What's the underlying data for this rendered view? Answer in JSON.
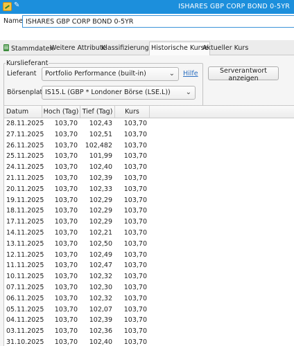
{
  "window": {
    "title": "ISHARES GBP CORP BOND 0-5YR"
  },
  "name_row": {
    "label": "Name",
    "value": "ISHARES GBP CORP BOND 0-5YR"
  },
  "tabs": [
    {
      "label": "Stammdaten",
      "active": false
    },
    {
      "label": "Weitere Attribute",
      "active": false
    },
    {
      "label": "Klassifizierungen",
      "active": false
    },
    {
      "label": "Historische Kurse",
      "active": true
    },
    {
      "label": "Aktueller Kurs",
      "active": false
    }
  ],
  "kurslieferant": {
    "legend": "Kurslieferant",
    "lieferant_label": "Lieferant",
    "lieferant_value": "Portfolio Performance (built-in)",
    "help_link": "Hilfe",
    "server_button": "Serverantwort anzeigen",
    "boersenplatz_label": "Börsenplatz",
    "boersenplatz_value": "IS15.L (GBP * Londoner Börse (LSE.L))"
  },
  "table": {
    "headers": [
      "Datum",
      "Hoch (Tag)",
      "Tief (Tag)",
      "Kurs"
    ],
    "rows": [
      [
        "28.11.2025",
        "103,70",
        "102,43",
        "103,70"
      ],
      [
        "27.11.2025",
        "103,70",
        "102,51",
        "103,70"
      ],
      [
        "26.11.2025",
        "103,70",
        "102,482",
        "103,70"
      ],
      [
        "25.11.2025",
        "103,70",
        "101,99",
        "103,70"
      ],
      [
        "24.11.2025",
        "103,70",
        "102,40",
        "103,70"
      ],
      [
        "21.11.2025",
        "103,70",
        "102,39",
        "103,70"
      ],
      [
        "20.11.2025",
        "103,70",
        "102,33",
        "103,70"
      ],
      [
        "19.11.2025",
        "103,70",
        "102,29",
        "103,70"
      ],
      [
        "18.11.2025",
        "103,70",
        "102,29",
        "103,70"
      ],
      [
        "17.11.2025",
        "103,70",
        "102,29",
        "103,70"
      ],
      [
        "14.11.2025",
        "103,70",
        "102,21",
        "103,70"
      ],
      [
        "13.11.2025",
        "103,70",
        "102,50",
        "103,70"
      ],
      [
        "12.11.2025",
        "103,70",
        "102,49",
        "103,70"
      ],
      [
        "11.11.2025",
        "103,70",
        "102,47",
        "103,70"
      ],
      [
        "10.11.2025",
        "103,70",
        "102,32",
        "103,70"
      ],
      [
        "07.11.2025",
        "103,70",
        "102,30",
        "103,70"
      ],
      [
        "06.11.2025",
        "103,70",
        "102,32",
        "103,70"
      ],
      [
        "05.11.2025",
        "103,70",
        "102,07",
        "103,70"
      ],
      [
        "04.11.2025",
        "103,70",
        "102,39",
        "103,70"
      ],
      [
        "03.11.2025",
        "103,70",
        "102,36",
        "103,70"
      ],
      [
        "31.10.2025",
        "103,70",
        "102,40",
        "103,70"
      ]
    ]
  },
  "colors": {
    "titlebar": "#1c8fdc",
    "link": "#2a6ec0",
    "input_focus": "#3c93d8"
  }
}
